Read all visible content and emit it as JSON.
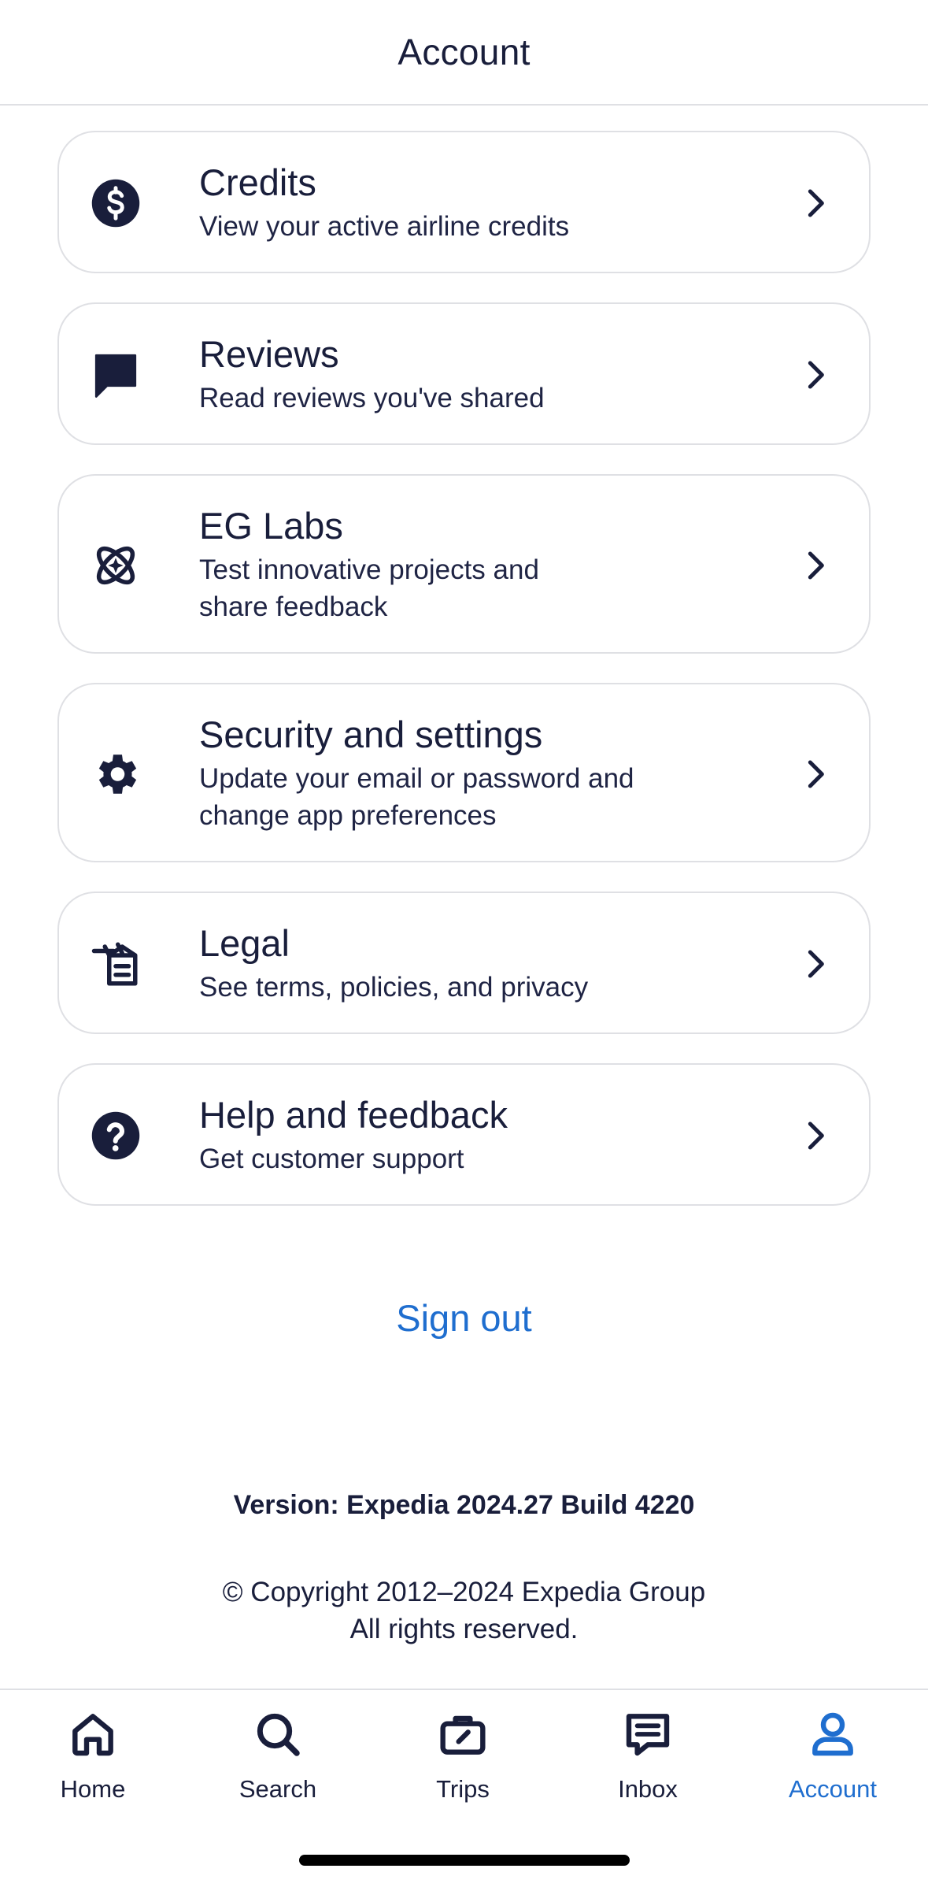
{
  "header": {
    "title": "Account"
  },
  "cards": [
    {
      "title": "Credits",
      "subtitle": "View your active airline credits",
      "icon": "dollar-circle-icon"
    },
    {
      "title": "Reviews",
      "subtitle": "Read reviews you've shared",
      "icon": "chat-bubble-icon"
    },
    {
      "title": "EG Labs",
      "subtitle_line1": "Test innovative projects and",
      "subtitle_line2": "share feedback",
      "icon": "atom-icon"
    },
    {
      "title": "Security and settings",
      "subtitle_line1": "Update your email or password and",
      "subtitle_line2": "change app preferences",
      "icon": "gear-icon"
    },
    {
      "title": "Legal",
      "subtitle": "See terms, policies, and privacy",
      "icon": "legal-document-icon"
    },
    {
      "title": "Help and feedback",
      "subtitle": "Get customer support",
      "icon": "question-circle-icon"
    }
  ],
  "sign_out": "Sign out",
  "version": "Version: Expedia 2024.27 Build 4220",
  "copyright_line1": "© Copyright 2012–2024 Expedia Group",
  "copyright_line2": "All rights reserved.",
  "tabs": [
    {
      "label": "Home",
      "icon": "home-icon"
    },
    {
      "label": "Search",
      "icon": "search-icon"
    },
    {
      "label": "Trips",
      "icon": "suitcase-icon"
    },
    {
      "label": "Inbox",
      "icon": "inbox-icon"
    },
    {
      "label": "Account",
      "icon": "account-icon",
      "active": true
    }
  ],
  "colors": {
    "text": "#191e3b",
    "accent": "#1f6ecf",
    "border": "#dfe0e4"
  }
}
